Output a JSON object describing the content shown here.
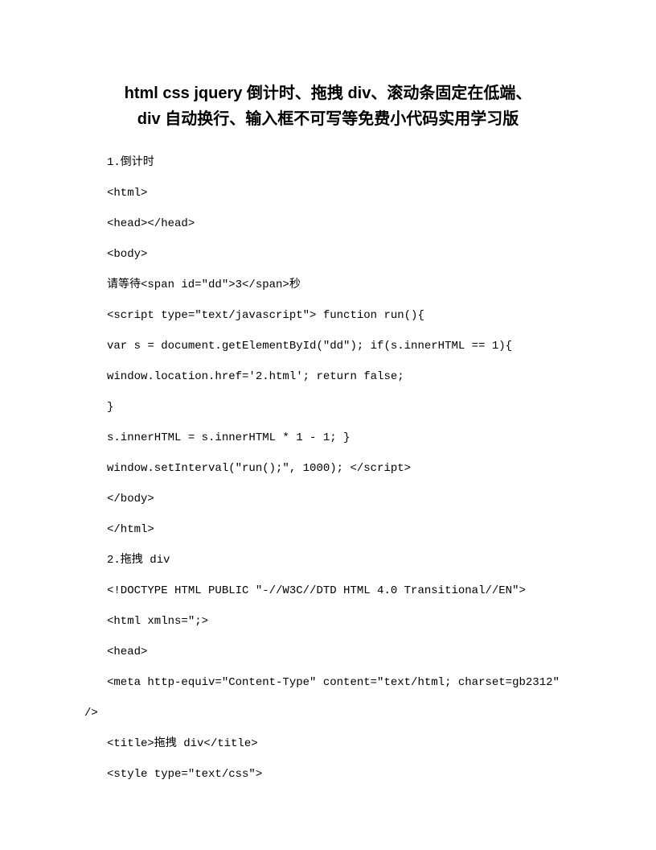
{
  "title_line1": "html css jquery 倒计时、拖拽 div、滚动条固定在低端、",
  "title_line2": "div 自动换行、输入框不可写等免费小代码实用学习版",
  "lines": [
    "1.倒计时",
    "<html>",
    "<head></head>",
    "<body>",
    "请等待<span id=\"dd\">3</span>秒",
    "<script type=\"text/javascript\"> function run(){",
    "var s = document.getElementById(\"dd\"); if(s.innerHTML == 1){",
    "window.location.href='2.html'; return false;",
    "}",
    "s.innerHTML = s.innerHTML * 1 - 1; }",
    "window.setInterval(\"run();\", 1000); </script>",
    "</body>",
    "</html>",
    "2.拖拽 div",
    "<!DOCTYPE HTML PUBLIC \"-//W3C//DTD HTML 4.0 Transitional//EN\">",
    "<html xmlns=\";>",
    "<head>",
    "<meta http-equiv=\"Content-Type\" content=\"text/html; charset=gb2312\"",
    "/>",
    "<title>拖拽 div</title>",
    "<style type=\"text/css\">"
  ]
}
